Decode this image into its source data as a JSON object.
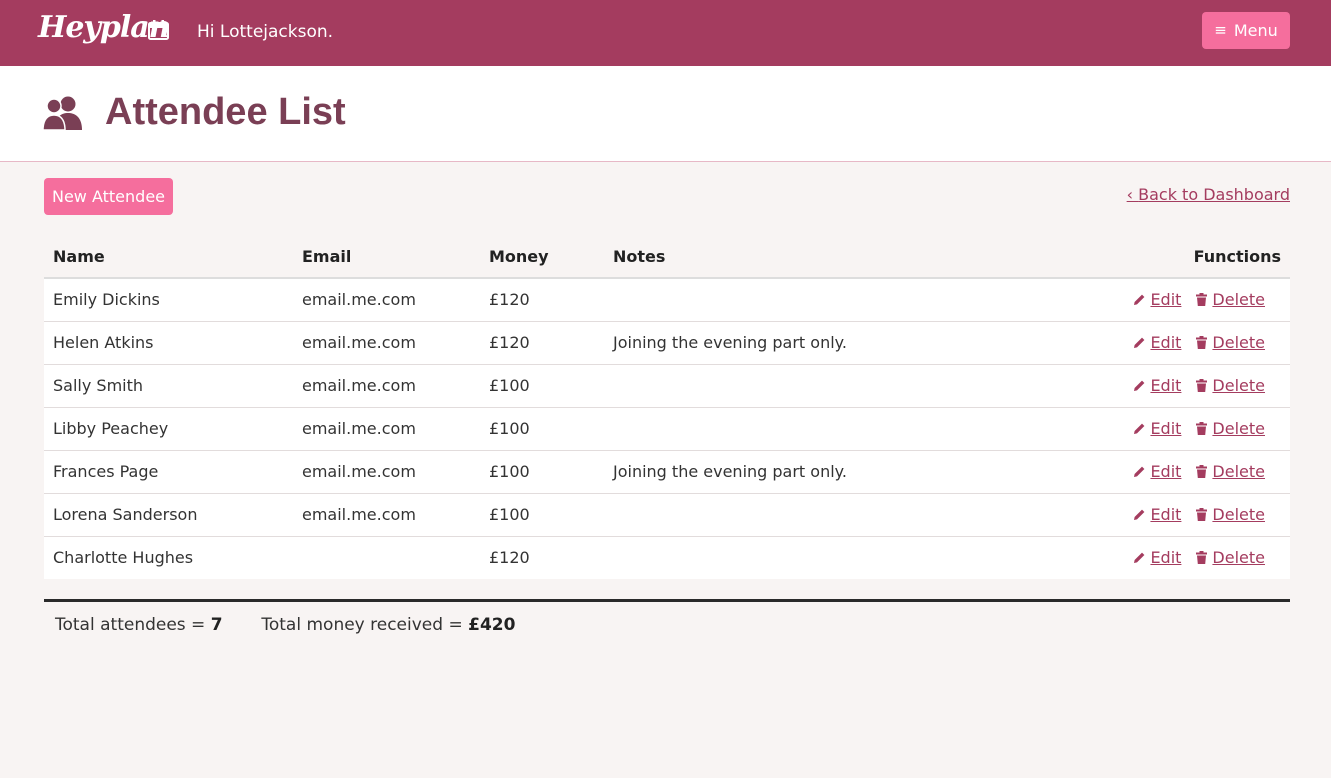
{
  "app": {
    "logo_text": "Heyplan",
    "greeting": "Hi Lottejackson.",
    "menu_label": "Menu"
  },
  "page": {
    "title": "Attendee List",
    "new_button": "New Attendee",
    "back_link": "Back to Dashboard"
  },
  "table": {
    "headers": {
      "name": "Name",
      "email": "Email",
      "money": "Money",
      "notes": "Notes",
      "functions": "Functions"
    },
    "edit_label": "Edit",
    "delete_label": "Delete",
    "rows": [
      {
        "name": "Emily Dickins",
        "email": "email.me.com",
        "money": "£120",
        "notes": ""
      },
      {
        "name": "Helen Atkins",
        "email": "email.me.com",
        "money": "£120",
        "notes": "Joining the evening part only."
      },
      {
        "name": "Sally Smith",
        "email": "email.me.com",
        "money": "£100",
        "notes": ""
      },
      {
        "name": "Libby Peachey",
        "email": "email.me.com",
        "money": "£100",
        "notes": ""
      },
      {
        "name": "Frances Page",
        "email": "email.me.com",
        "money": "£100",
        "notes": "Joining the evening part only."
      },
      {
        "name": "Lorena Sanderson",
        "email": "email.me.com",
        "money": "£100",
        "notes": ""
      },
      {
        "name": "Charlotte Hughes",
        "email": "",
        "money": "£120",
        "notes": ""
      }
    ]
  },
  "totals": {
    "attendees_label": "Total attendees = ",
    "attendees_value": "7",
    "money_label": "Total money received = ",
    "money_value": "£420"
  },
  "colors": {
    "topbar": "#a43c5f",
    "accent_button": "#f56e9d",
    "title": "#7a3f55",
    "link": "#a43c5f"
  },
  "icons": {
    "logo": "calendar-icon",
    "menu": "hamburger-icon",
    "title": "users-icon",
    "back": "chevron-left-icon",
    "edit": "pencil-icon",
    "delete": "trash-icon"
  }
}
